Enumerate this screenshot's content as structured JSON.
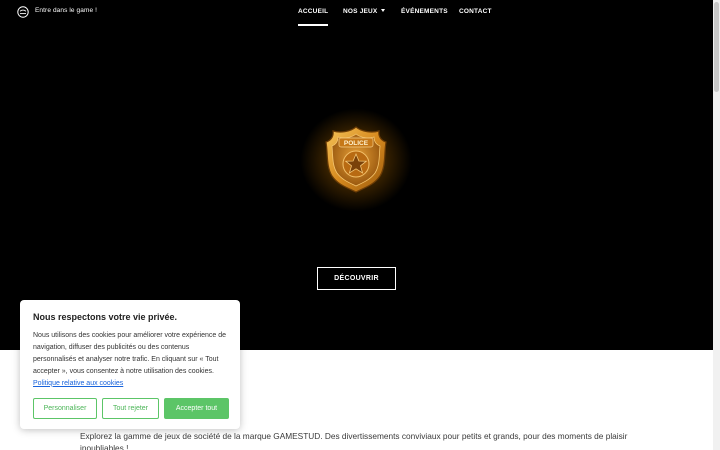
{
  "header": {
    "tagline": "Entre dans le game !",
    "logo_icon": "gamestud-logo-icon",
    "nav": [
      {
        "label": "ACCUEIL",
        "active": true
      },
      {
        "label": "NOS JEUX",
        "has_dropdown": true
      },
      {
        "label": "ÉVÉNEMENTS"
      },
      {
        "label": "CONTACT"
      }
    ]
  },
  "hero": {
    "badge_text": "POLICE",
    "badge_icon": "police-badge-icon",
    "cta_label": "DÉCOUVRIR",
    "background": "#000000",
    "glow_color": "#ffb928"
  },
  "intro": {
    "text": "Explorez la gamme de jeux de société de la marque GAMESTUD. Des divertissements conviviaux pour petits et grands, pour des moments de plaisir inoubliables !"
  },
  "cookie_banner": {
    "title": "Nous respectons votre vie privée.",
    "text": "Nous utilisons des cookies pour améliorer votre expérience de navigation, diffuser des publicités ou des contenus personnalisés et analyser notre trafic. En cliquant sur « Tout accepter », vous consentez à notre utilisation des cookies.",
    "link_label": "Politique relative aux cookies",
    "buttons": {
      "customize": "Personnaliser",
      "reject": "Tout rejeter",
      "accept": "Accepter tout"
    },
    "accent_color": "#5cc567",
    "link_color": "#1863dc"
  }
}
